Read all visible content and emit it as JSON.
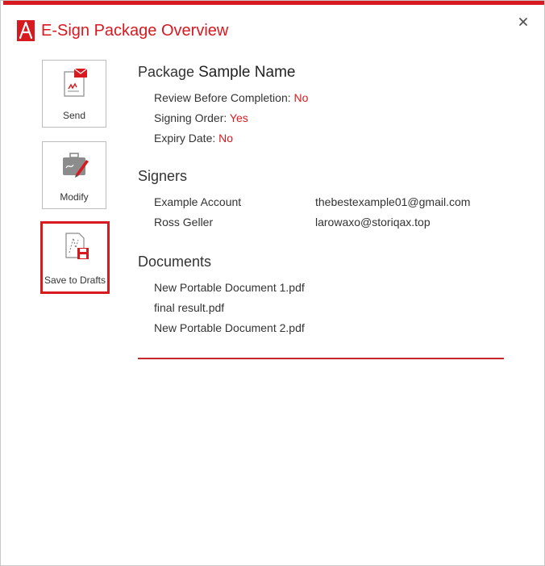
{
  "dialog": {
    "title": "E-Sign Package Overview",
    "close_icon": "close-icon",
    "accent_color": "#d71920"
  },
  "actions": {
    "send_label": "Send",
    "modify_label": "Modify",
    "save_drafts_label": "Save to Drafts"
  },
  "package": {
    "prefix": "Package",
    "name": "Sample Name",
    "review_label": "Review Before Completion:",
    "review_value": "No",
    "signing_order_label": "Signing Order:",
    "signing_order_value": "Yes",
    "expiry_label": "Expiry Date:",
    "expiry_value": "No"
  },
  "signers": {
    "title": "Signers",
    "items": [
      {
        "name": "Example Account",
        "email": "thebestexample01@gmail.com"
      },
      {
        "name": "Ross Geller",
        "email": "larowaxo@storiqax.top"
      }
    ]
  },
  "documents": {
    "title": "Documents",
    "items": [
      "New Portable Document 1.pdf",
      "final result.pdf",
      "New Portable Document 2.pdf"
    ]
  }
}
